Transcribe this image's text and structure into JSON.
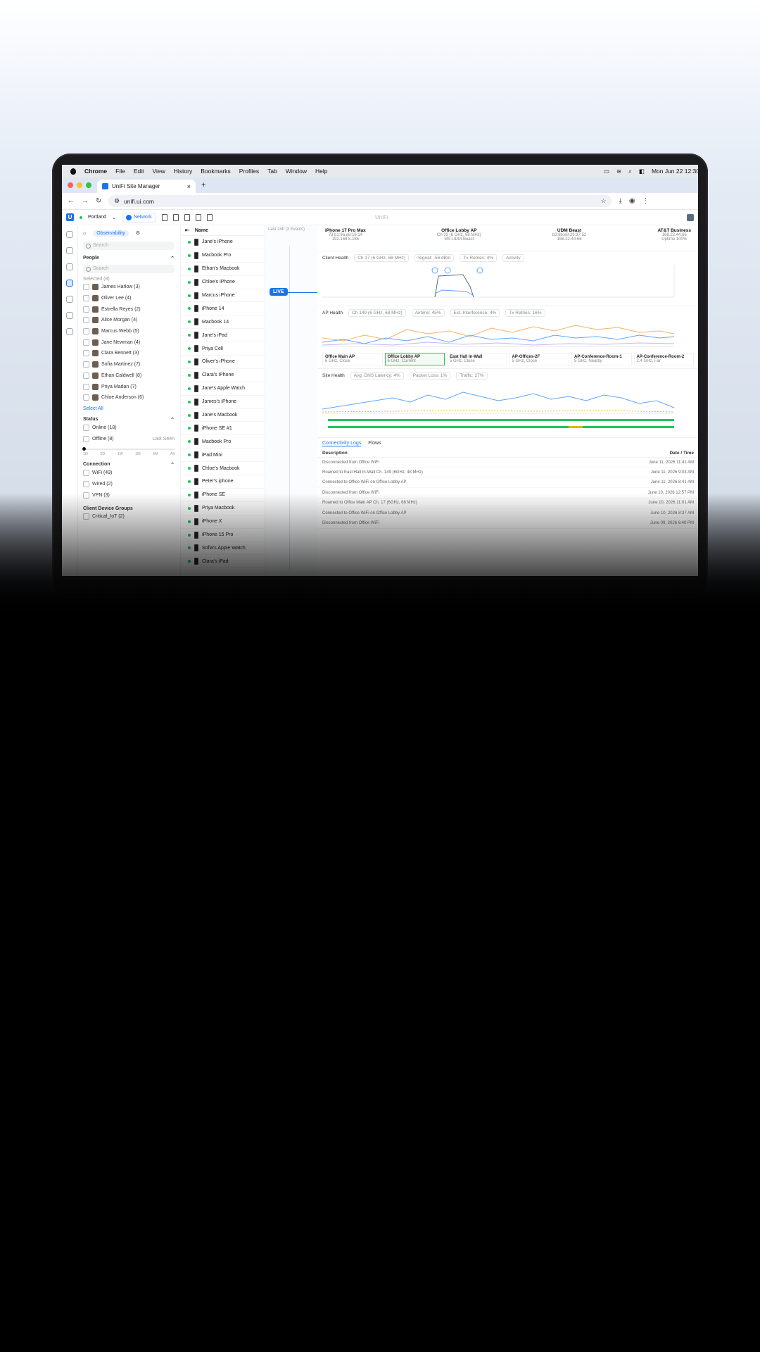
{
  "menubar": {
    "app": "Chrome",
    "items": [
      "File",
      "Edit",
      "View",
      "History",
      "Bookmarks",
      "Profiles",
      "Tab",
      "Window",
      "Help"
    ],
    "clock": "Mon Jun 22  12:30"
  },
  "browser": {
    "tab_title": "UniFi Site Manager",
    "url": "unifi.ui.com"
  },
  "unifi": {
    "site": "Portland",
    "network_label": "Network",
    "app_title": "UniFi"
  },
  "filters": {
    "tab_label": "Observability",
    "search_placeholder": "Search",
    "people_title": "People",
    "people_search_placeholder": "Search",
    "selected": "Selected (8)",
    "people": [
      {
        "name": "James Harlow (3)"
      },
      {
        "name": "Oliver Lee (4)"
      },
      {
        "name": "Estrella Reyes (2)"
      },
      {
        "name": "Alice Morgan (4)"
      },
      {
        "name": "Marcus Webb (5)"
      },
      {
        "name": "Jane Newman (4)"
      },
      {
        "name": "Clara Bennett (3)"
      },
      {
        "name": "Sofia Martinez (7)"
      },
      {
        "name": "Ethan Caldwell (8)"
      },
      {
        "name": "Priya Madan (7)"
      },
      {
        "name": "Chloe Anderson (6)"
      }
    ],
    "select_all": "Select All",
    "status_title": "Status",
    "status": [
      "Online (18)",
      "Offline (8)"
    ],
    "last_seen": "Last Seen",
    "ticks": [
      "1D",
      "3D",
      "1W",
      "1M",
      "6M",
      "All"
    ],
    "connection_title": "Connection",
    "connection": [
      "WiFi (49)",
      "Wired (2)",
      "VPN (3)"
    ],
    "groups_title": "Client Device Groups",
    "groups": [
      "Critical_IoT (2)"
    ]
  },
  "clients": {
    "header": "Name",
    "items": [
      "Jane's iPhone",
      "Macbook Pro",
      "Ethan's Macbook",
      "Chloe's iPhone",
      "Marcus iPhone",
      "iPhone 14",
      "Macbook 14",
      "Jane's iPad",
      "Priya Cell",
      "Oliver's iPhone",
      "Clara's iPhone",
      "Jane's Apple Watch",
      "James's iPhone",
      "Jane's Macbook",
      "iPhone SE #1",
      "Macbook Pro",
      "iPad Mini",
      "Chloe's Macbook",
      "Peter's iphone",
      "iPhone SE",
      "Priya Macbook",
      "iPhone X",
      "iPhone 15 Pro",
      "Sofia's Apple Watch",
      "Clara's iPad"
    ]
  },
  "timeline": {
    "range": "Last 24h (3 Events)",
    "live": "LIVE"
  },
  "topology": [
    {
      "name": "iPhone 17 Pro Max",
      "sub": "78:b1:9a:a8:16:14",
      "sub2": "192.168.8.185"
    },
    {
      "name": "Office Lobby AP",
      "sub": "Ch 33 (6 GHz, 68 MHz)",
      "sub2": "MS-UDM-Beast"
    },
    {
      "name": "UDM Beast",
      "sub": "b2:8b:e8:29:37:52",
      "sub2": "168.22.44.66"
    },
    {
      "name": "AT&T Business",
      "sub": "168.22.44.66",
      "sub2": "Uptime 100%"
    }
  ],
  "client_health": {
    "title": "Client Health",
    "chips": [
      "Ch 17 (6 GHz, 68 MHz)",
      "Signal: -56 dBm",
      "Tx Retries: 4%",
      "Activity"
    ]
  },
  "ap_health": {
    "title": "AP Health",
    "chips": [
      "Ch 149 (6 GHz, 68 MHz)",
      "Airtime: 45%",
      "Ext. Interference: 4%",
      "Tx Retries: 16%"
    ],
    "aps": [
      {
        "name": "Office Main AP",
        "sub": "6 GHz, Close"
      },
      {
        "name": "Office Lobby AP",
        "sub": "6 GHz, Current"
      },
      {
        "name": "East Hall In-Wall",
        "sub": "5 GHz, Close"
      },
      {
        "name": "AP-Offices-2F",
        "sub": "5 GHz, Close"
      },
      {
        "name": "AP-Conference-Room-1",
        "sub": "5 GHz, Nearby"
      },
      {
        "name": "AP-Conference-Room-2",
        "sub": "2.4 GHz, Far"
      }
    ]
  },
  "site_health": {
    "title": "Site Health",
    "chips": [
      "Avg. DNS Latency: 4%",
      "Packet Loss: 1%",
      "Traffic: 27%"
    ]
  },
  "logs": {
    "tabs": [
      "Connectivity Logs",
      "Flows"
    ],
    "col_desc": "Description",
    "col_date": "Date / Time",
    "rows": [
      {
        "desc": "Disconnected from Office WiFi",
        "date": "June 11, 2026 11:41 AM"
      },
      {
        "desc": "Roamed to East Hall In-Wall Ch. 149 (6GHz, 48 MHz)",
        "date": "June 11, 2026 9:03 AM"
      },
      {
        "desc": "Connected to Office WiFi on Office Lobby AP",
        "date": "June 11, 2026 8:41 AM"
      },
      {
        "desc": "Disconnected from Office WiFi",
        "date": "June 10, 2026 12:57 PM"
      },
      {
        "desc": "Roamed to Office Main AP Ch. 17 (6GHz, 68 MHz)",
        "date": "June 10, 2026 11:01 AM"
      },
      {
        "desc": "Connected to Office WiFi on Office Lobby AP",
        "date": "June 10, 2026 8:37 AM"
      },
      {
        "desc": "Disconnected from Office WiFi",
        "date": "June 09, 2026 6:40 PM"
      }
    ]
  }
}
